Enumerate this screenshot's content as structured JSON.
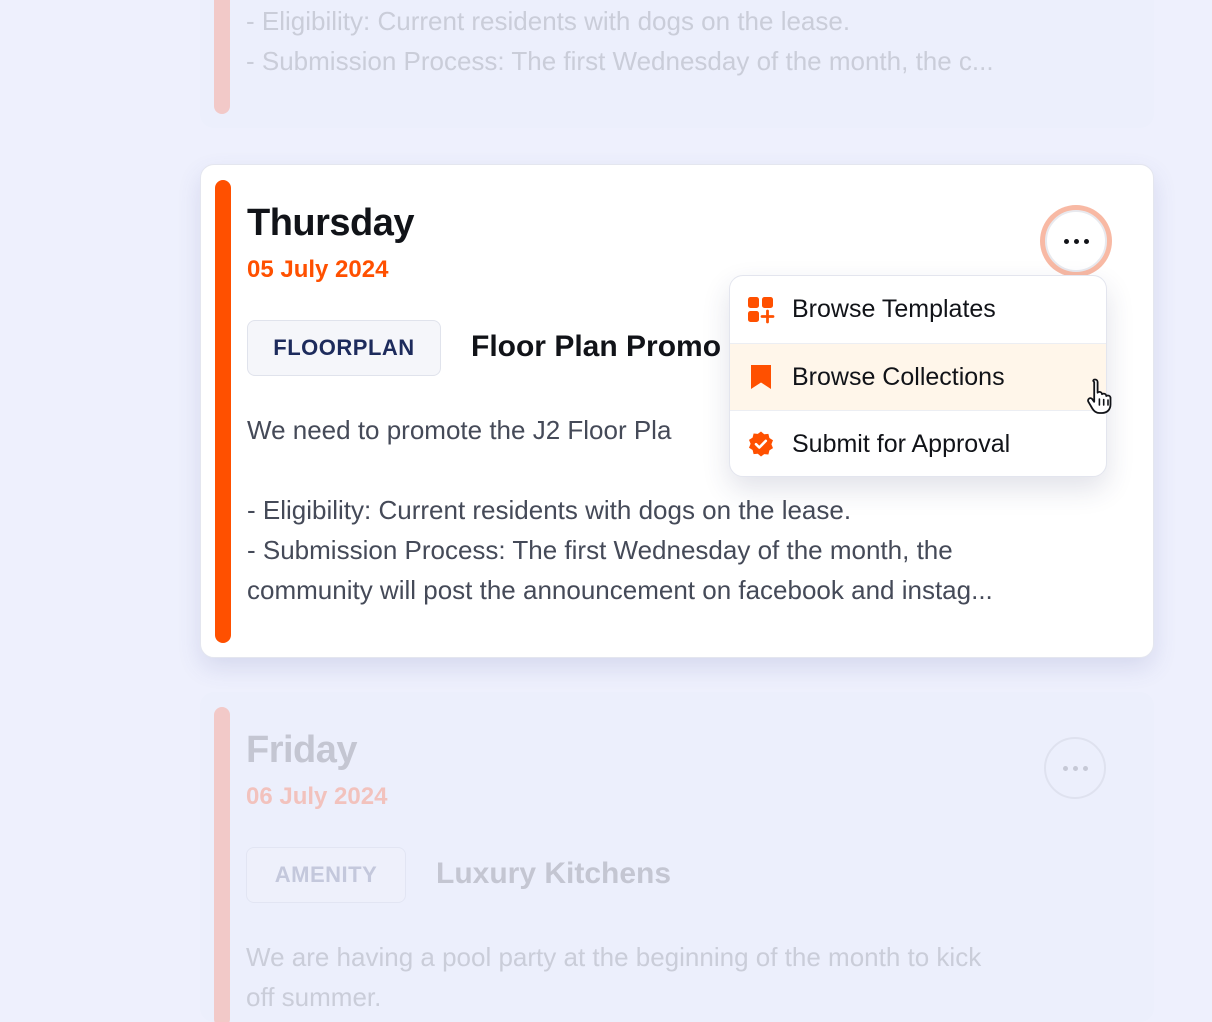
{
  "colors": {
    "accent": "#ff5000",
    "page_bg": "#eef0fd",
    "menu_highlight": "#fff6ea"
  },
  "cards": {
    "previous": {
      "body_line1": "- Eligibility: Current residents with dogs on the lease.",
      "body_line2": "- Submission Process: The first Wednesday of the month, the c..."
    },
    "current": {
      "day": "Thursday",
      "date": "05 July 2024",
      "tag": "FLOORPLAN",
      "title": "Floor Plan Promo",
      "body_line1": "We need to promote the J2 Floor Pla",
      "body_line2": "- Eligibility: Current residents with dogs on the lease.",
      "body_line3": "- Submission Process: The first Wednesday of the month, the",
      "body_line4": "community will post the announcement on facebook and instag...",
      "more_icon": "more-horizontal-icon"
    },
    "next": {
      "day": "Friday",
      "date": "06 July 2024",
      "tag": "AMENITY",
      "title": "Luxury Kitchens",
      "body_line1": "We are having a pool party at the beginning of the month to kick",
      "body_line2": "off summer.",
      "more_icon": "more-horizontal-icon"
    }
  },
  "menu": {
    "items": [
      {
        "label": "Browse Templates",
        "icon": "templates-grid-icon",
        "highlighted": false
      },
      {
        "label": "Browse Collections",
        "icon": "bookmark-icon",
        "highlighted": true
      },
      {
        "label": "Submit for Approval",
        "icon": "verified-badge-icon",
        "highlighted": false
      }
    ]
  },
  "cursor": "pointer-hand-icon"
}
